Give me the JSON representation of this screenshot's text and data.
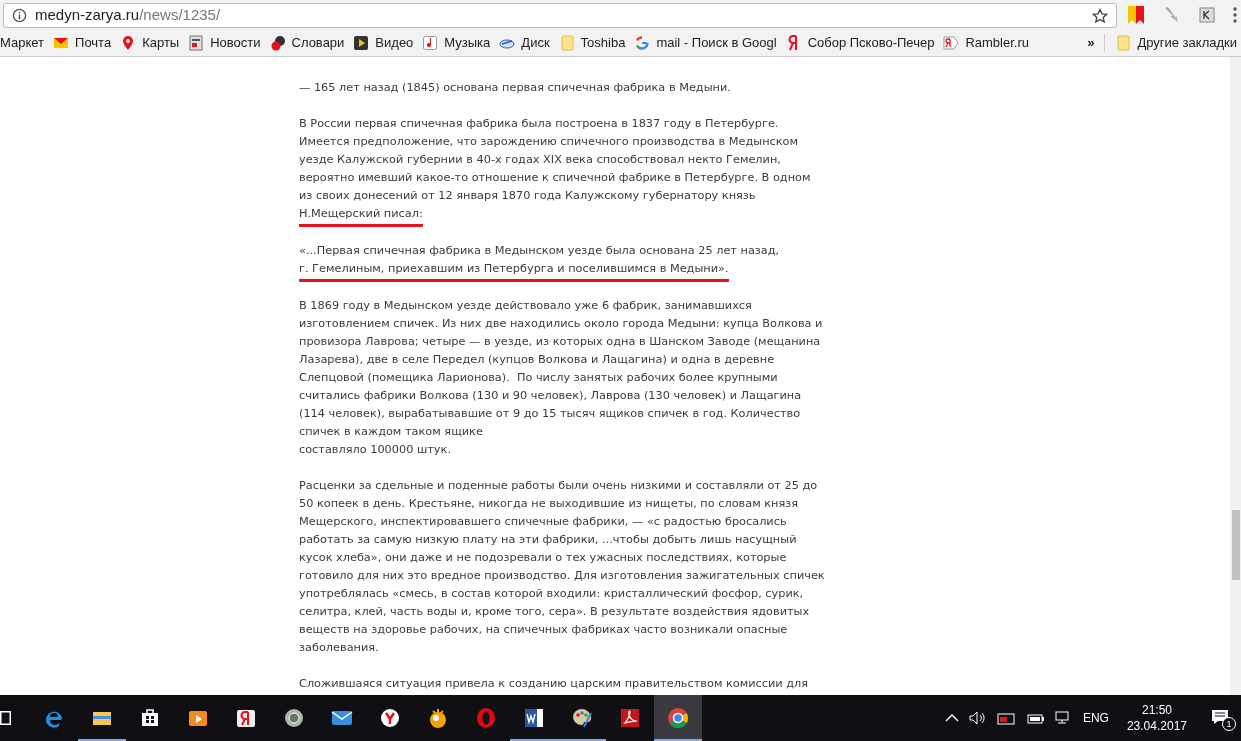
{
  "browser": {
    "url_host": "medyn-zarya.ru",
    "url_path": "/news/1235/"
  },
  "bookmarks": [
    {
      "label": "Маркет",
      "kind": "none"
    },
    {
      "label": "Почта",
      "kind": "mail"
    },
    {
      "label": "Карты",
      "kind": "pin"
    },
    {
      "label": "Новости",
      "kind": "news"
    },
    {
      "label": "Словари",
      "kind": "dict"
    },
    {
      "label": "Видео",
      "kind": "video"
    },
    {
      "label": "Музыка",
      "kind": "music"
    },
    {
      "label": "Диск",
      "kind": "disk"
    },
    {
      "label": "Toshiba",
      "kind": "folder"
    },
    {
      "label": "mail - Поиск в Googl",
      "kind": "google"
    },
    {
      "label": "Собор Псково-Печер",
      "kind": "yandex"
    },
    {
      "label": "Rambler.ru",
      "kind": "rambler"
    }
  ],
  "bookmarks_more": "»",
  "other_bookmarks": "Другие закладки",
  "article": [
    {
      "lines": [
        "— 165 лет назад (1845) основана первая спичечная фабрика в Медыни."
      ],
      "underlined": false
    },
    {
      "lines": [
        "В России первая спичечная фабрика была построена в 1837 году в Петербурге.",
        "Имеется предположение, что зарождению спичечного производства в Медынском",
        "уезде Калужской губернии в 40-х годах XIX века способствовал некто Гемелин,",
        "вероятно имевший какое-то отношение к спичечной фабрике в Петербурге. В одном",
        "из своих донесений от 12 января 1870 года Калужскому губернатору князь",
        "Н.Мещерский писал:"
      ],
      "underlined": true
    },
    {
      "lines": [
        "«...Первая спичечная фабрика в Медынском уезде была основана 25 лет назад,",
        "г. Гемелиным, приехавшим из Петербурга и поселившимся в Медыни»."
      ],
      "underlined": true
    },
    {
      "lines": [
        "В 1869 году в Медынском уезде действовало уже 6 фабрик, занимавшихся",
        "изготовлением спичек. Из них две находились около города Медыни: купца Волкова и",
        "провизора Лаврова; четыре — в уезде, из которых одна в Шанском Заводе (мещанина",
        "Лазарева), две в селе Передел (купцов Волкова и Лащагина) и одна в деревне",
        "Слепцовой (помещика Ларионова).  По числу занятых рабочих более крупными",
        "считались фабрики Волкова (130 и 90 человек), Лаврова (130 человек) и Лащагина",
        "(114 человек), вырабатывавшие от 9 до 15 тысяч ящиков спичек в год. Количество",
        "спичек в каждом таком ящике",
        "составляло 100000 штук."
      ],
      "underlined": false
    },
    {
      "lines": [
        "Расценки за сдельные и поденные работы были очень низкими и составляли от 25 до",
        "50 копеек в день. Крестьяне, никогда не выходившие из нищеты, по словам князя",
        "Мещерского, инспектировавшего спичечные фабрики, — «с радостью бросались",
        "работать за самую низкую плату на эти фабрики, ...чтобы добыть лишь насущный",
        "кусок хлеба», они даже и не подозревали о тех ужасных последствиях, которые",
        "готовило для них это вредное производство. Для изготовления зажигательных спичек",
        "употреблялась «смесь, в состав которой входили: кристаллический фосфор, сурик,",
        "селитра, клей, часть воды и, кроме того, сера». В результате воздействия ядовитых",
        "веществ на здоровье рабочих, на спичечных фабриках часто возникали опасные",
        "заболевания."
      ],
      "underlined": false
    },
    {
      "lines": [
        "Сложившаяся ситуация привела к созданию царским правительством комиссии для"
      ],
      "underlined": false
    }
  ],
  "taskbar": {
    "apps": [
      {
        "kind": "taskview",
        "running": false,
        "selected": false
      },
      {
        "kind": "edge",
        "running": false,
        "selected": false
      },
      {
        "kind": "explorer",
        "running": true,
        "selected": false
      },
      {
        "kind": "store",
        "running": false,
        "selected": false
      },
      {
        "kind": "player",
        "running": false,
        "selected": false
      },
      {
        "kind": "yandex",
        "running": false,
        "selected": false
      },
      {
        "kind": "disc",
        "running": false,
        "selected": false
      },
      {
        "kind": "mail",
        "running": false,
        "selected": false
      },
      {
        "kind": "ybrowser",
        "running": false,
        "selected": false
      },
      {
        "kind": "fireball",
        "running": false,
        "selected": false
      },
      {
        "kind": "opera",
        "running": false,
        "selected": false
      },
      {
        "kind": "word",
        "running": true,
        "selected": false
      },
      {
        "kind": "paint",
        "running": true,
        "selected": false
      },
      {
        "kind": "pdf",
        "running": false,
        "selected": false
      },
      {
        "kind": "chrome",
        "running": true,
        "selected": true
      }
    ],
    "language": "ENG",
    "time": "21:50",
    "date": "23.04.2017",
    "notifications": "1"
  }
}
